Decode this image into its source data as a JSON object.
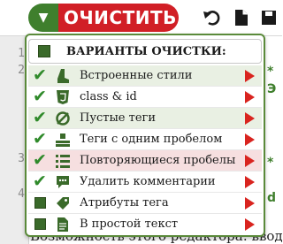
{
  "toolbar": {
    "clean_label": "ОЧИСТИТЬ",
    "dropdown_arrow": "▼"
  },
  "editor": {
    "line_numbers": [
      "1",
      "2",
      "3",
      "4"
    ],
    "bottom_text": "Возможность этого редактора: вводи"
  },
  "menu": {
    "header": "ВАРИАНТЫ ОЧИСТКИ:",
    "options": [
      {
        "label": "Встроенные стили",
        "checked": true,
        "icon": "boot-icon"
      },
      {
        "label": "class & id",
        "checked": true,
        "icon": "css-icon"
      },
      {
        "label": "Пустые теги",
        "checked": true,
        "icon": "empty-icon"
      },
      {
        "label": "Теги с одним пробелом",
        "checked": true,
        "icon": "space-icon"
      },
      {
        "label": "Повторяющиеся пробелы",
        "checked": true,
        "icon": "repeat-icon"
      },
      {
        "label": "Удалить комментарии",
        "checked": true,
        "icon": "comment-icon"
      },
      {
        "label": "Атрибуты тега",
        "checked": false,
        "icon": "tag-icon"
      },
      {
        "label": "В простой текст",
        "checked": false,
        "icon": "doc-icon"
      }
    ]
  },
  "colors": {
    "accent_green": "#3f7f2d",
    "accent_red": "#d11f26",
    "check_green": "#2f8a2a",
    "arrow_red": "#d9241f"
  }
}
